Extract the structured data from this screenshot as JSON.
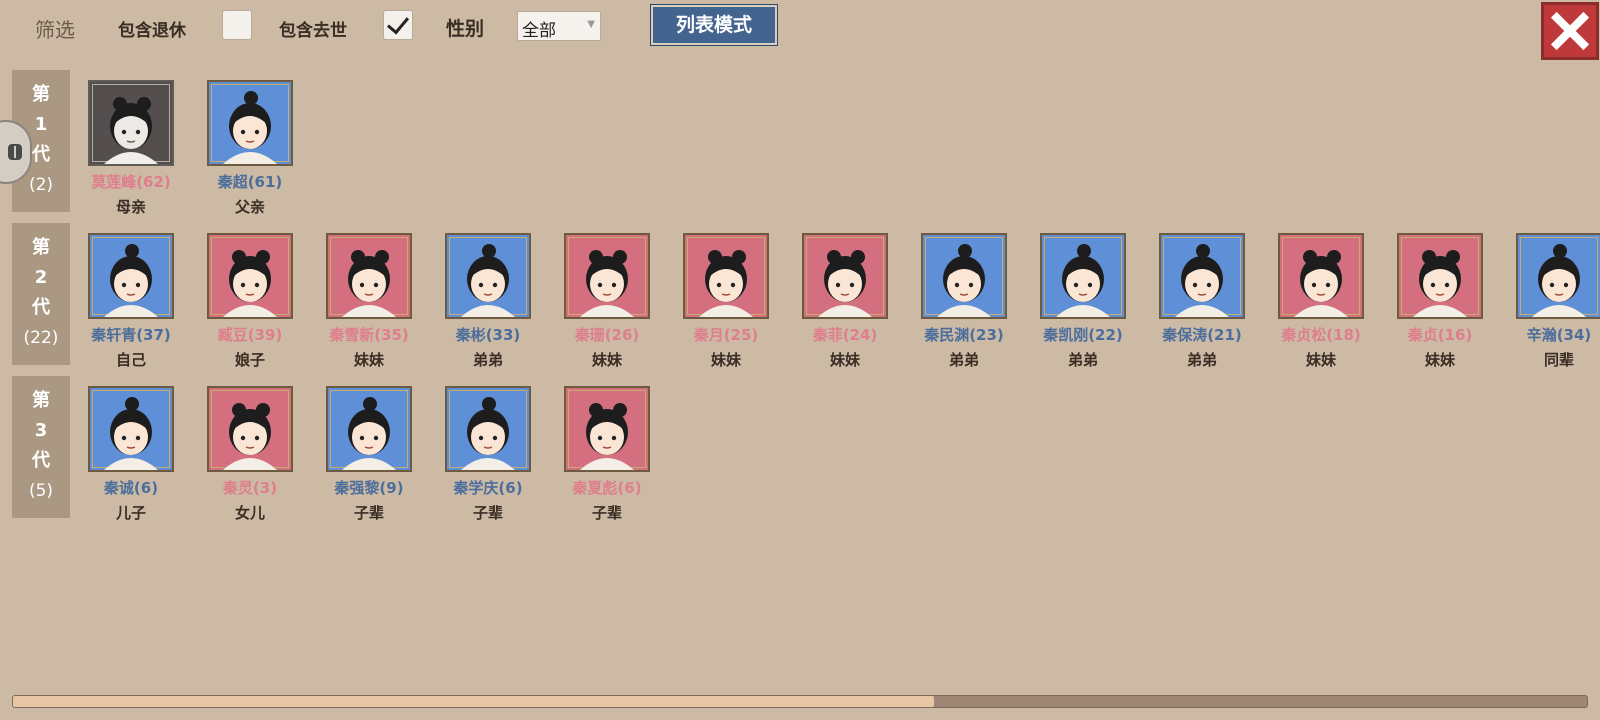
{
  "filter": {
    "title": "筛选",
    "include_retired_label": "包含退休",
    "include_retired_checked": false,
    "include_deceased_label": "包含去世",
    "include_deceased_checked": true,
    "gender_label": "性别",
    "gender_value": "全部",
    "list_mode_label": "列表模式"
  },
  "colors": {
    "background": "#cdbaa5",
    "male": "#5f8fd6",
    "female": "#d46f80",
    "male_name": "#4c6e9c",
    "female_name": "#df7e8d",
    "close_red": "#c0393a",
    "list_mode_blue": "#43648e"
  },
  "generations": [
    {
      "label": "第1代",
      "chars": [
        "第",
        "1",
        "代"
      ],
      "count": "(2)",
      "members": [
        {
          "name": "莫莲峰(62)",
          "relation": "母亲",
          "gender": "female",
          "deceased": true
        },
        {
          "name": "秦超(61)",
          "relation": "父亲",
          "gender": "male",
          "deceased": false
        }
      ]
    },
    {
      "label": "第2代",
      "chars": [
        "第",
        "2",
        "代"
      ],
      "count": "(22)",
      "members": [
        {
          "name": "秦轩青(37)",
          "relation": "自己",
          "gender": "male",
          "deceased": false
        },
        {
          "name": "臧豆(39)",
          "relation": "娘子",
          "gender": "female",
          "deceased": false
        },
        {
          "name": "秦雪新(35)",
          "relation": "妹妹",
          "gender": "female",
          "deceased": false
        },
        {
          "name": "秦彬(33)",
          "relation": "弟弟",
          "gender": "male",
          "deceased": false
        },
        {
          "name": "秦珊(26)",
          "relation": "妹妹",
          "gender": "female",
          "deceased": false
        },
        {
          "name": "秦月(25)",
          "relation": "妹妹",
          "gender": "female",
          "deceased": false
        },
        {
          "name": "秦菲(24)",
          "relation": "妹妹",
          "gender": "female",
          "deceased": false
        },
        {
          "name": "秦民渊(23)",
          "relation": "弟弟",
          "gender": "male",
          "deceased": false
        },
        {
          "name": "秦凯刚(22)",
          "relation": "弟弟",
          "gender": "male",
          "deceased": false
        },
        {
          "name": "秦保涛(21)",
          "relation": "弟弟",
          "gender": "male",
          "deceased": false
        },
        {
          "name": "秦贞松(18)",
          "relation": "妹妹",
          "gender": "female",
          "deceased": false
        },
        {
          "name": "秦贞(16)",
          "relation": "妹妹",
          "gender": "female",
          "deceased": false
        },
        {
          "name": "辛瀚(34)",
          "relation": "同辈",
          "gender": "male",
          "deceased": false
        }
      ]
    },
    {
      "label": "第3代",
      "chars": [
        "第",
        "3",
        "代"
      ],
      "count": "(5)",
      "members": [
        {
          "name": "秦诚(6)",
          "relation": "儿子",
          "gender": "male",
          "deceased": false
        },
        {
          "name": "秦灵(3)",
          "relation": "女儿",
          "gender": "female",
          "deceased": false
        },
        {
          "name": "秦强黎(9)",
          "relation": "子辈",
          "gender": "male",
          "deceased": false
        },
        {
          "name": "秦学庆(6)",
          "relation": "子辈",
          "gender": "male",
          "deceased": false
        },
        {
          "name": "秦夏彪(6)",
          "relation": "子辈",
          "gender": "female",
          "deceased": false
        }
      ]
    }
  ],
  "scroll": {
    "position_fraction": 0.585
  }
}
